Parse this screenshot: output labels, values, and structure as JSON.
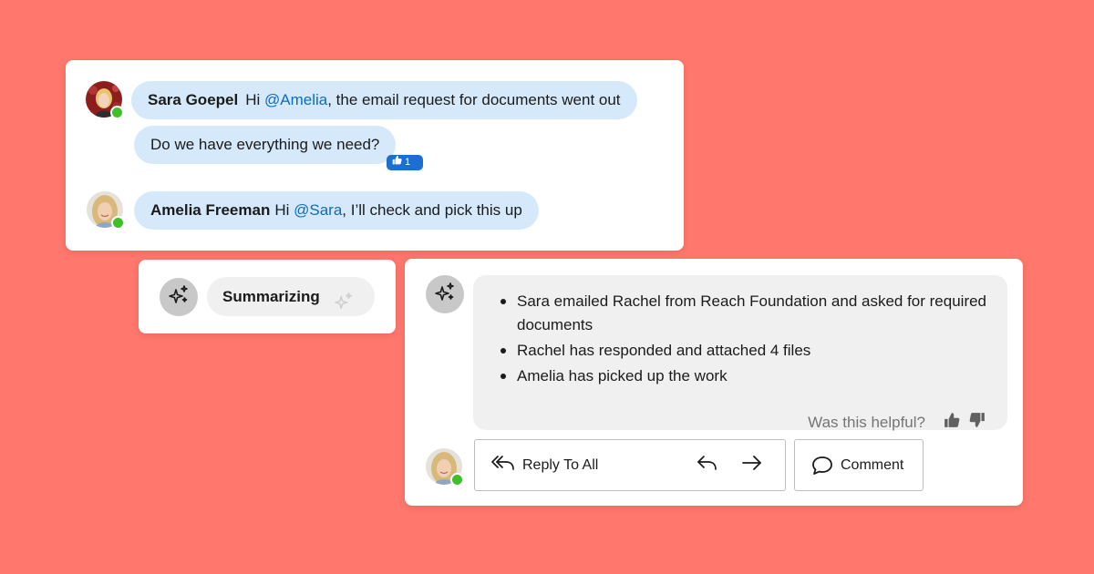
{
  "chat": {
    "messages": [
      {
        "sender": "Sara Goepel",
        "text_prefix": "Hi ",
        "mention": "@Amelia",
        "text_suffix": ", the email request for documents went out",
        "avatar": "sara-avatar",
        "presence": "available"
      },
      {
        "text": "Do we have everything we need?",
        "reaction": {
          "icon": "thumbs-up-icon",
          "count": "1"
        }
      },
      {
        "sender": "Amelia Freeman",
        "text_prefix": "Hi ",
        "mention": "@Sara",
        "text_suffix": ", I’ll check and pick this up",
        "avatar": "amelia-avatar",
        "presence": "available"
      }
    ]
  },
  "summarizing": {
    "label": "Summarizing",
    "icon": "sparkle-icon"
  },
  "summary": {
    "items": [
      "Sara emailed Rachel from Reach Foundation and asked for required documents",
      "Rachel has responded and attached 4 files",
      "Amelia has picked up the work"
    ],
    "feedback": {
      "question": "Was this helpful?",
      "thumbs_up_icon": "thumbs-up-icon",
      "thumbs_down_icon": "thumbs-down-icon"
    }
  },
  "actions": {
    "reply_all_label": "Reply To All",
    "comment_label": "Comment"
  },
  "colors": {
    "background": "#FF776D",
    "bubble": "#D5E9FB",
    "mention": "#0F6CBD",
    "presence": "#3FBF2A",
    "reaction": "#1A6FD0"
  }
}
